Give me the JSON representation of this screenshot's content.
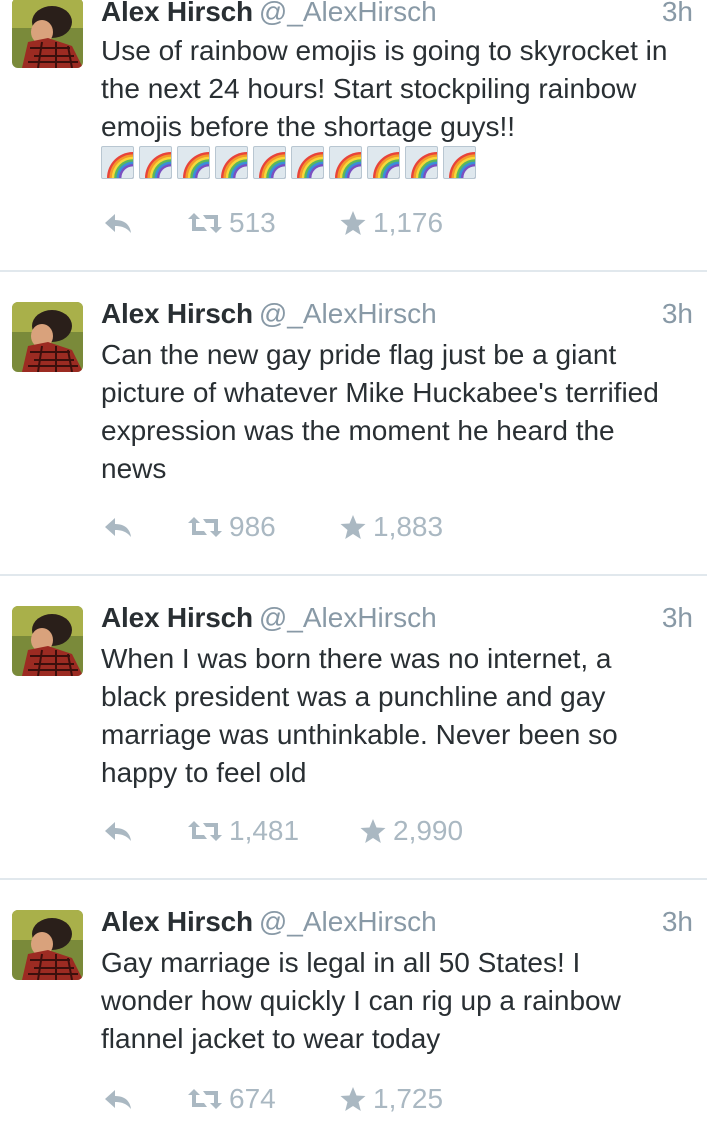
{
  "tweets": [
    {
      "name": "Alex Hirsch",
      "handle": "@_AlexHirsch",
      "time": "3h",
      "text": "Use of rainbow emojis is going to skyrocket in the next 24 hours! Start stockpiling rainbow emojis before the shortage guys!!",
      "emoji_count": 10,
      "retweets": "513",
      "favorites": "1,176"
    },
    {
      "name": "Alex Hirsch",
      "handle": "@_AlexHirsch",
      "time": "3h",
      "text": "Can the new gay pride flag just be a giant picture of whatever Mike Huckabee's terrified expression was the moment he heard the news",
      "retweets": "986",
      "favorites": "1,883"
    },
    {
      "name": "Alex Hirsch",
      "handle": "@_AlexHirsch",
      "time": "3h",
      "text": "When I was born there was no internet,  a black president was a punchline and gay marriage was unthinkable. Never been so happy to feel old",
      "retweets": "1,481",
      "favorites": "2,990"
    },
    {
      "name": "Alex Hirsch",
      "handle": "@_AlexHirsch",
      "time": "3h",
      "text": "Gay marriage is legal in all 50 States! I wonder how quickly I can rig up a rainbow flannel jacket to wear today",
      "retweets": "674",
      "favorites": "1,725"
    }
  ],
  "icons": {
    "reply": "reply-icon",
    "retweet": "retweet-icon",
    "favorite": "star-icon",
    "emoji": "rainbow-emoji-icon"
  },
  "colors": {
    "name_text": "#292f33",
    "muted_text": "#8899a6",
    "action_icons": "#aab8c2",
    "divider": "#e1e8ed"
  }
}
